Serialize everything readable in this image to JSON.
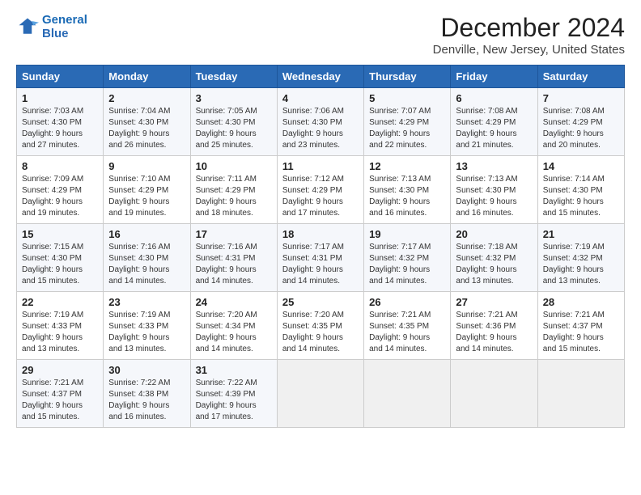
{
  "logo": {
    "line1": "General",
    "line2": "Blue"
  },
  "title": "December 2024",
  "subtitle": "Denville, New Jersey, United States",
  "weekdays": [
    "Sunday",
    "Monday",
    "Tuesday",
    "Wednesday",
    "Thursday",
    "Friday",
    "Saturday"
  ],
  "weeks": [
    [
      {
        "day": "1",
        "sunrise": "Sunrise: 7:03 AM",
        "sunset": "Sunset: 4:30 PM",
        "daylight": "Daylight: 9 hours and 27 minutes."
      },
      {
        "day": "2",
        "sunrise": "Sunrise: 7:04 AM",
        "sunset": "Sunset: 4:30 PM",
        "daylight": "Daylight: 9 hours and 26 minutes."
      },
      {
        "day": "3",
        "sunrise": "Sunrise: 7:05 AM",
        "sunset": "Sunset: 4:30 PM",
        "daylight": "Daylight: 9 hours and 25 minutes."
      },
      {
        "day": "4",
        "sunrise": "Sunrise: 7:06 AM",
        "sunset": "Sunset: 4:30 PM",
        "daylight": "Daylight: 9 hours and 23 minutes."
      },
      {
        "day": "5",
        "sunrise": "Sunrise: 7:07 AM",
        "sunset": "Sunset: 4:29 PM",
        "daylight": "Daylight: 9 hours and 22 minutes."
      },
      {
        "day": "6",
        "sunrise": "Sunrise: 7:08 AM",
        "sunset": "Sunset: 4:29 PM",
        "daylight": "Daylight: 9 hours and 21 minutes."
      },
      {
        "day": "7",
        "sunrise": "Sunrise: 7:08 AM",
        "sunset": "Sunset: 4:29 PM",
        "daylight": "Daylight: 9 hours and 20 minutes."
      }
    ],
    [
      {
        "day": "8",
        "sunrise": "Sunrise: 7:09 AM",
        "sunset": "Sunset: 4:29 PM",
        "daylight": "Daylight: 9 hours and 19 minutes."
      },
      {
        "day": "9",
        "sunrise": "Sunrise: 7:10 AM",
        "sunset": "Sunset: 4:29 PM",
        "daylight": "Daylight: 9 hours and 19 minutes."
      },
      {
        "day": "10",
        "sunrise": "Sunrise: 7:11 AM",
        "sunset": "Sunset: 4:29 PM",
        "daylight": "Daylight: 9 hours and 18 minutes."
      },
      {
        "day": "11",
        "sunrise": "Sunrise: 7:12 AM",
        "sunset": "Sunset: 4:29 PM",
        "daylight": "Daylight: 9 hours and 17 minutes."
      },
      {
        "day": "12",
        "sunrise": "Sunrise: 7:13 AM",
        "sunset": "Sunset: 4:30 PM",
        "daylight": "Daylight: 9 hours and 16 minutes."
      },
      {
        "day": "13",
        "sunrise": "Sunrise: 7:13 AM",
        "sunset": "Sunset: 4:30 PM",
        "daylight": "Daylight: 9 hours and 16 minutes."
      },
      {
        "day": "14",
        "sunrise": "Sunrise: 7:14 AM",
        "sunset": "Sunset: 4:30 PM",
        "daylight": "Daylight: 9 hours and 15 minutes."
      }
    ],
    [
      {
        "day": "15",
        "sunrise": "Sunrise: 7:15 AM",
        "sunset": "Sunset: 4:30 PM",
        "daylight": "Daylight: 9 hours and 15 minutes."
      },
      {
        "day": "16",
        "sunrise": "Sunrise: 7:16 AM",
        "sunset": "Sunset: 4:30 PM",
        "daylight": "Daylight: 9 hours and 14 minutes."
      },
      {
        "day": "17",
        "sunrise": "Sunrise: 7:16 AM",
        "sunset": "Sunset: 4:31 PM",
        "daylight": "Daylight: 9 hours and 14 minutes."
      },
      {
        "day": "18",
        "sunrise": "Sunrise: 7:17 AM",
        "sunset": "Sunset: 4:31 PM",
        "daylight": "Daylight: 9 hours and 14 minutes."
      },
      {
        "day": "19",
        "sunrise": "Sunrise: 7:17 AM",
        "sunset": "Sunset: 4:32 PM",
        "daylight": "Daylight: 9 hours and 14 minutes."
      },
      {
        "day": "20",
        "sunrise": "Sunrise: 7:18 AM",
        "sunset": "Sunset: 4:32 PM",
        "daylight": "Daylight: 9 hours and 13 minutes."
      },
      {
        "day": "21",
        "sunrise": "Sunrise: 7:19 AM",
        "sunset": "Sunset: 4:32 PM",
        "daylight": "Daylight: 9 hours and 13 minutes."
      }
    ],
    [
      {
        "day": "22",
        "sunrise": "Sunrise: 7:19 AM",
        "sunset": "Sunset: 4:33 PM",
        "daylight": "Daylight: 9 hours and 13 minutes."
      },
      {
        "day": "23",
        "sunrise": "Sunrise: 7:19 AM",
        "sunset": "Sunset: 4:33 PM",
        "daylight": "Daylight: 9 hours and 13 minutes."
      },
      {
        "day": "24",
        "sunrise": "Sunrise: 7:20 AM",
        "sunset": "Sunset: 4:34 PM",
        "daylight": "Daylight: 9 hours and 14 minutes."
      },
      {
        "day": "25",
        "sunrise": "Sunrise: 7:20 AM",
        "sunset": "Sunset: 4:35 PM",
        "daylight": "Daylight: 9 hours and 14 minutes."
      },
      {
        "day": "26",
        "sunrise": "Sunrise: 7:21 AM",
        "sunset": "Sunset: 4:35 PM",
        "daylight": "Daylight: 9 hours and 14 minutes."
      },
      {
        "day": "27",
        "sunrise": "Sunrise: 7:21 AM",
        "sunset": "Sunset: 4:36 PM",
        "daylight": "Daylight: 9 hours and 14 minutes."
      },
      {
        "day": "28",
        "sunrise": "Sunrise: 7:21 AM",
        "sunset": "Sunset: 4:37 PM",
        "daylight": "Daylight: 9 hours and 15 minutes."
      }
    ],
    [
      {
        "day": "29",
        "sunrise": "Sunrise: 7:21 AM",
        "sunset": "Sunset: 4:37 PM",
        "daylight": "Daylight: 9 hours and 15 minutes."
      },
      {
        "day": "30",
        "sunrise": "Sunrise: 7:22 AM",
        "sunset": "Sunset: 4:38 PM",
        "daylight": "Daylight: 9 hours and 16 minutes."
      },
      {
        "day": "31",
        "sunrise": "Sunrise: 7:22 AM",
        "sunset": "Sunset: 4:39 PM",
        "daylight": "Daylight: 9 hours and 17 minutes."
      },
      null,
      null,
      null,
      null
    ]
  ]
}
